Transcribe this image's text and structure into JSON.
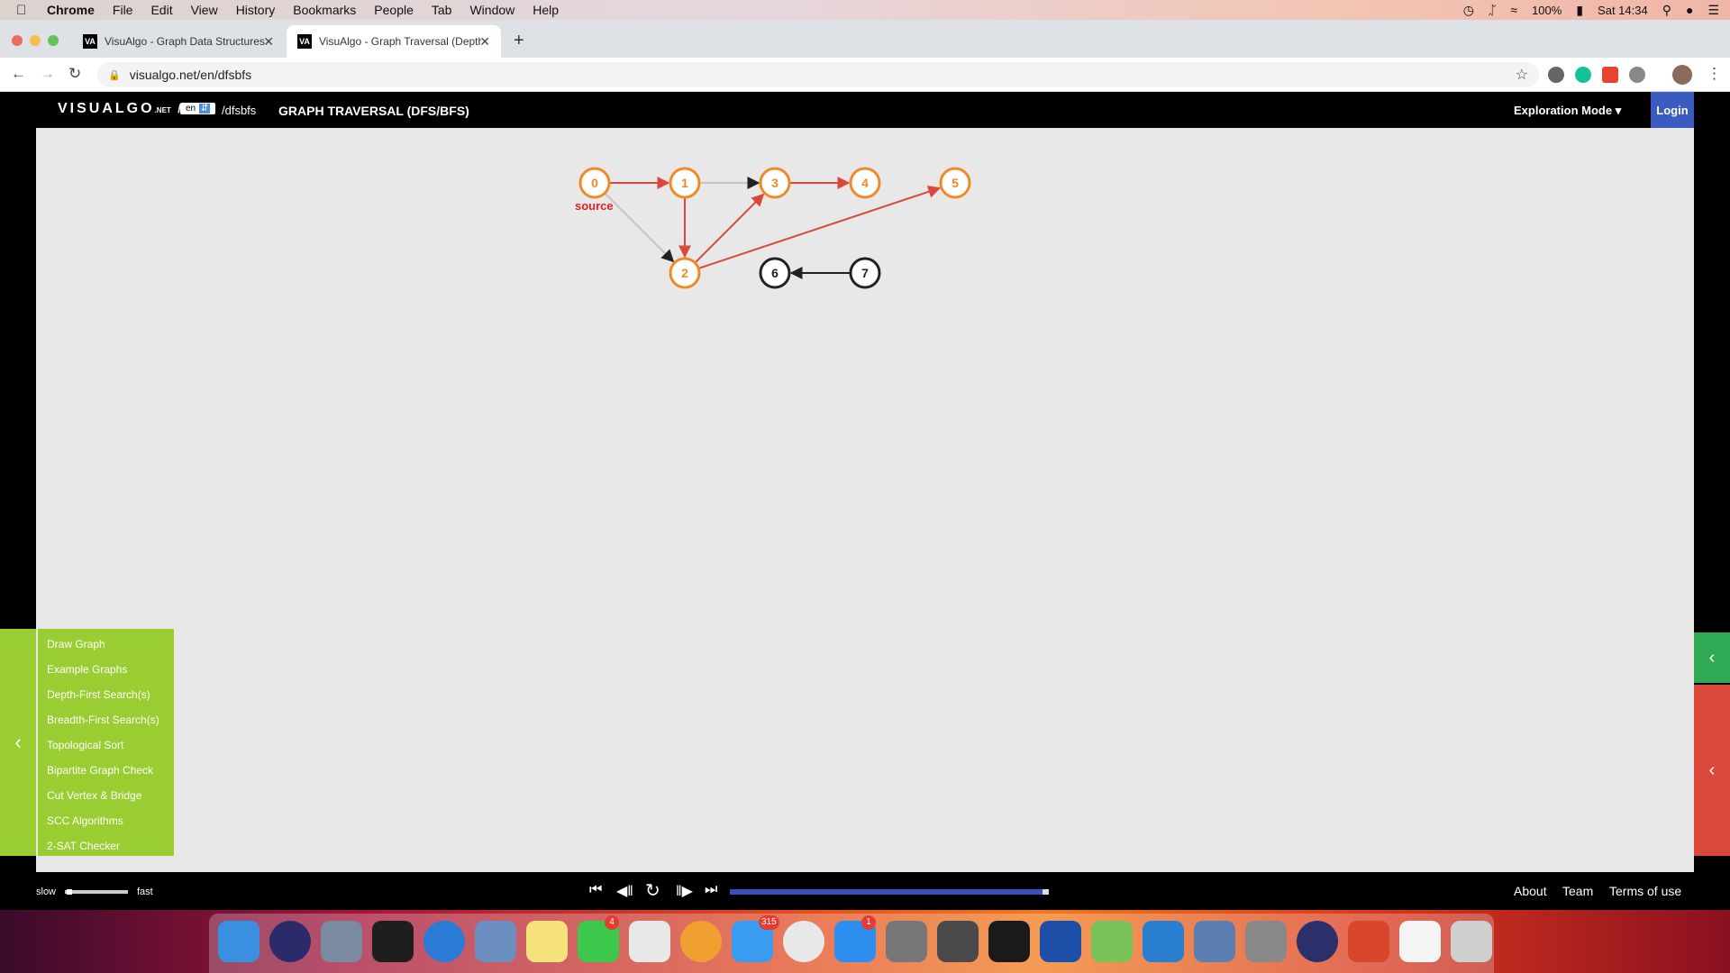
{
  "menubar": {
    "app": "Chrome",
    "items": [
      "File",
      "Edit",
      "View",
      "History",
      "Bookmarks",
      "People",
      "Tab",
      "Window",
      "Help"
    ],
    "battery": "100%",
    "clock": "Sat 14:34"
  },
  "tabs": [
    {
      "title": "VisuAlgo - Graph Data Structures",
      "favicon": "VA"
    },
    {
      "title": "VisuAlgo - Graph Traversal (Depth/Breadth First Search)",
      "favicon": "VA"
    }
  ],
  "address": {
    "url": "visualgo.net/en/dfsbfs"
  },
  "header": {
    "logo_main": "VISUALGO",
    "logo_net": ".NET",
    "slash": "/",
    "lang": "en",
    "path": "/dfsbfs",
    "title": "GRAPH TRAVERSAL (DFS/BFS)",
    "mode": "Exploration Mode",
    "login": "Login"
  },
  "graph": {
    "vertices": [
      {
        "id": "0",
        "color": "orange"
      },
      {
        "id": "1",
        "color": "orange"
      },
      {
        "id": "2",
        "color": "orange"
      },
      {
        "id": "3",
        "color": "orange"
      },
      {
        "id": "4",
        "color": "orange"
      },
      {
        "id": "5",
        "color": "orange"
      },
      {
        "id": "6",
        "color": "black"
      },
      {
        "id": "7",
        "color": "black"
      }
    ],
    "edges": [
      {
        "from": "0",
        "to": "1",
        "state": "tree"
      },
      {
        "from": "0",
        "to": "2",
        "state": "nontree"
      },
      {
        "from": "1",
        "to": "3",
        "state": "nontree"
      },
      {
        "from": "1",
        "to": "2",
        "state": "tree"
      },
      {
        "from": "2",
        "to": "3",
        "state": "tree"
      },
      {
        "from": "3",
        "to": "4",
        "state": "tree"
      },
      {
        "from": "2",
        "to": "5",
        "state": "tree"
      },
      {
        "from": "7",
        "to": "6",
        "state": "unvisited"
      }
    ],
    "source_label": "source",
    "colors": {
      "orange": "#f08a24",
      "tree": "#d9483b",
      "nontree": "#c4c4c4",
      "black": "#222222"
    }
  },
  "sidebar": {
    "items": [
      "Draw Graph",
      "Example Graphs",
      "Depth-First Search(s)",
      "Breadth-First Search(s)",
      "Topological Sort",
      "Bipartite Graph Check",
      "Cut Vertex & Bridge",
      "SCC Algorithms",
      "2-SAT Checker"
    ]
  },
  "controls": {
    "slow": "slow",
    "fast": "fast",
    "progress": 0.98
  },
  "footer": {
    "about": "About",
    "team": "Team",
    "terms": "Terms of use"
  },
  "dock": {
    "apps": [
      "finder",
      "siri",
      "launchpad",
      "activity-monitor",
      "safari",
      "preview-eagle",
      "notes",
      "facetime",
      "calendar",
      "photos",
      "messages",
      "chrome",
      "app-store",
      "system-preferences",
      "sublime-text",
      "terminal",
      "word",
      "android-studio",
      "xcode",
      "preview",
      "image-capture",
      "eclipse",
      "powerpoint",
      "pdf-document",
      "trash"
    ],
    "badges": {
      "facetime": "4",
      "messages": "315",
      "app-store": "1"
    }
  }
}
